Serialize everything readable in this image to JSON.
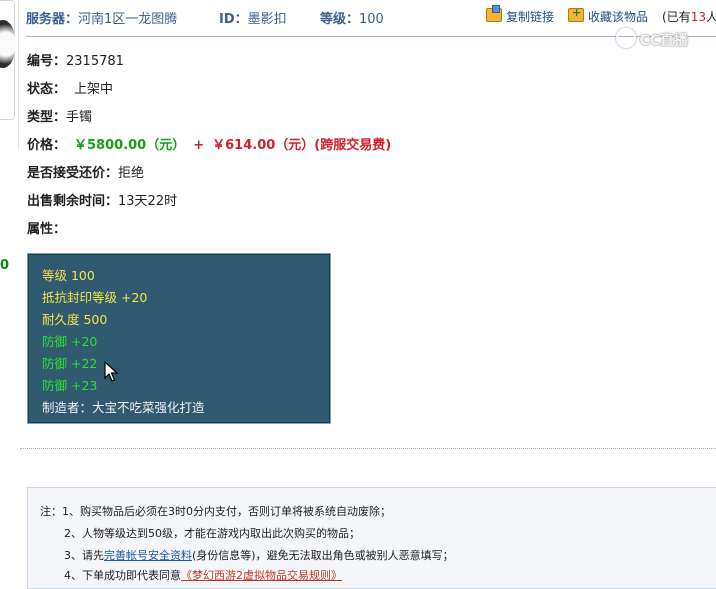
{
  "header": {
    "server_label": "服务器：",
    "server_value": "河南1区一龙图腾",
    "id_label": "ID：",
    "id_value": "墨影扣",
    "level_label": "等级：",
    "level_value": "100",
    "copy_link": "复制链接",
    "favorite": "收藏该物品",
    "fav_count_prefix": "(已有",
    "fav_count_num": "13",
    "fav_count_suffix": "人"
  },
  "watermark": "CC直播",
  "side_value": "0",
  "item": {
    "id_label": "编号：",
    "id_value": "2315781",
    "status_label": "状态：",
    "status_value": "上架中",
    "type_label": "类型：",
    "type_value": "手镯",
    "price_label": "价格：",
    "price_value": "￥5800.00（元）",
    "price_plus": "+",
    "fee_value": "￥614.00（元）(跨服交易费)",
    "counter_label": "是否接受还价：",
    "counter_value": "拒绝",
    "time_label": "出售剩余时间：",
    "time_value": "13天22时",
    "attr_label": "属性："
  },
  "attributes": [
    {
      "text": "等级 100",
      "color": "#f4e34a"
    },
    {
      "text": "抵抗封印等级 +20",
      "color": "#f4e34a"
    },
    {
      "text": "耐久度 500",
      "color": "#f4e34a"
    },
    {
      "text": "防御 +20",
      "color": "#2fe02f"
    },
    {
      "text": "防御 +22",
      "color": "#2fe02f"
    },
    {
      "text": "防御 +23",
      "color": "#2fe02f"
    },
    {
      "text": "制造者：大宝不吃菜强化打造",
      "color": "#f0f0f0"
    }
  ],
  "notes": {
    "prefix": "注：",
    "line1": "1、购买物品后必须在3时0分内支付，否则订单将被系统自动废除；",
    "line2": "2、人物等级达到50级，才能在游戏内取出此次购买的物品；",
    "line3_a": "3、请先",
    "line3_link": "完善帐号安全资料",
    "line3_b": "(身份信息等)，避免无法取出角色或被别人恶意填写；",
    "line4_a": "4、下单成功即代表同意",
    "line4_link": "《梦幻西游2虚拟物品交易规则》"
  }
}
